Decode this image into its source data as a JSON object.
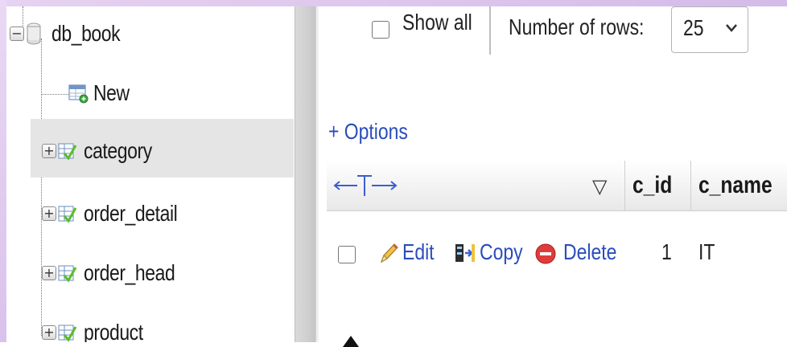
{
  "navigation": {
    "database": "db_book",
    "new_label": "New",
    "tables": [
      "category",
      "order_detail",
      "order_head",
      "product"
    ],
    "selected": "category"
  },
  "toolbar": {
    "show_all_label": "Show all",
    "rows_label": "Number of rows:",
    "rows_value": "25",
    "options_label": "+ Options"
  },
  "table": {
    "headers": [
      "c_id",
      "c_name"
    ],
    "sort_glyph": "▽",
    "rows": [
      {
        "edit": "Edit",
        "copy": "Copy",
        "delete": "Delete",
        "c_id": "1",
        "c_name": "IT"
      }
    ]
  },
  "colors": {
    "link": "#2a4dbb",
    "delete_red": "#e03b3b",
    "frame": "#d9c2ec"
  }
}
